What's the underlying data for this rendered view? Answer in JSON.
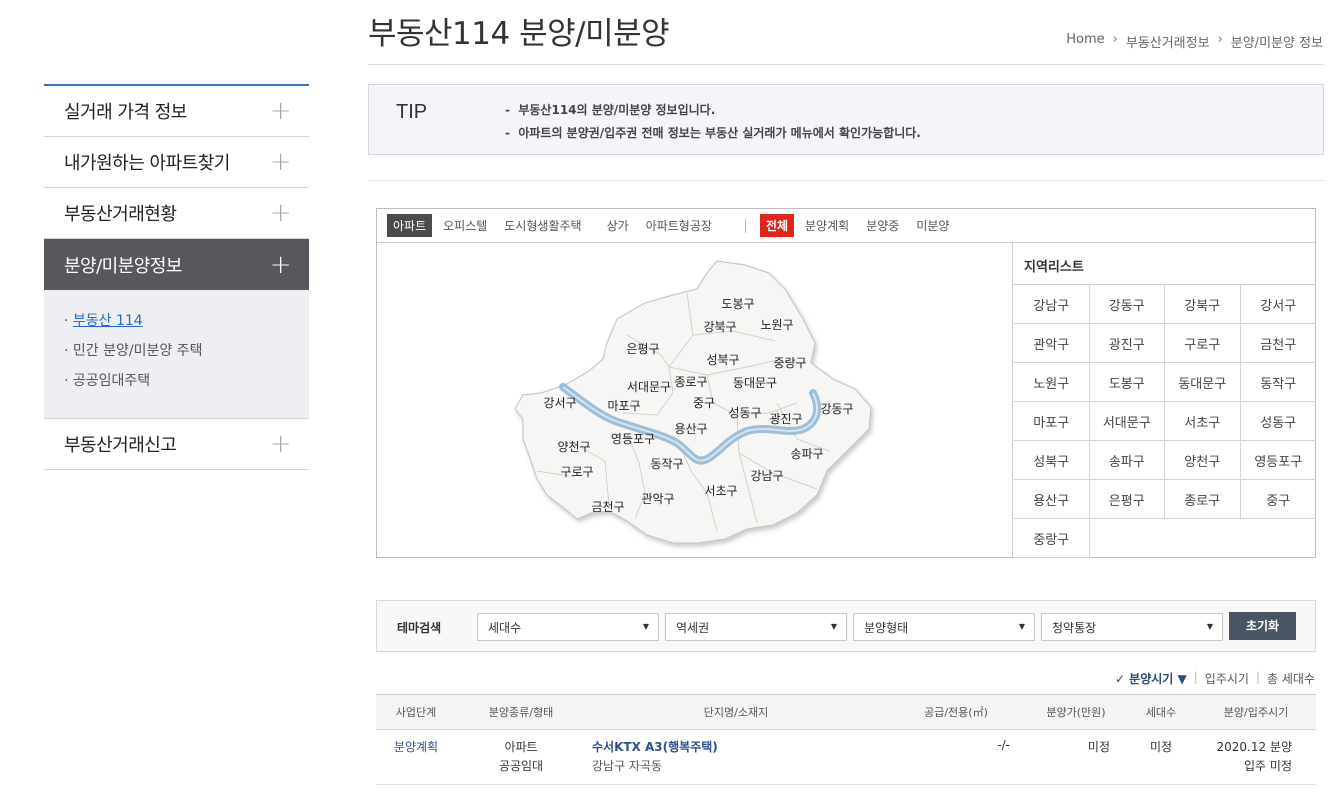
{
  "header": {
    "title": "부동산114 분양/미분양",
    "breadcrumb": [
      "Home",
      "부동산거래정보",
      "분양/미분양 정보"
    ]
  },
  "sidebar": {
    "items": [
      {
        "label": "실거래 가격 정보"
      },
      {
        "label": "내가원하는 아파트찾기"
      },
      {
        "label": "부동산거래현황"
      },
      {
        "label": "분양/미분양정보"
      },
      {
        "label": "부동산거래신고"
      }
    ],
    "sub_items": [
      {
        "label": "부동산 114"
      },
      {
        "label": "민간 분양/미분양 주택"
      },
      {
        "label": "공공임대주택"
      }
    ]
  },
  "tip": {
    "label": "TIP",
    "lines": [
      "부동산114의 분양/미분양 정보입니다.",
      "아파트의 분양권/입주권 전매 정보는 부동산 실거래가 메뉴에서 확인가능합니다."
    ]
  },
  "tabs": {
    "type_tabs": [
      "아파트",
      "오피스텔",
      "도시형생활주택",
      "상가",
      "아파트형공장"
    ],
    "status_tabs": [
      "전체",
      "분양계획",
      "분양중",
      "미분양"
    ]
  },
  "map": {
    "districts": [
      "도봉구",
      "강북구",
      "노원구",
      "은평구",
      "성북구",
      "중랑구",
      "서대문구",
      "종로구",
      "동대문구",
      "강서구",
      "마포구",
      "중구",
      "성동구",
      "광진구",
      "강동구",
      "양천구",
      "영등포구",
      "용산구",
      "송파구",
      "구로구",
      "동작구",
      "강남구",
      "금천구",
      "관악구",
      "서초구"
    ]
  },
  "regions": {
    "title": "지역리스트",
    "list": [
      "강남구",
      "강동구",
      "강북구",
      "강서구",
      "관악구",
      "광진구",
      "구로구",
      "금천구",
      "노원구",
      "도봉구",
      "동대문구",
      "동작구",
      "마포구",
      "서대문구",
      "서초구",
      "성동구",
      "성북구",
      "송파구",
      "양천구",
      "영등포구",
      "용산구",
      "은평구",
      "종로구",
      "중구",
      "중랑구"
    ]
  },
  "theme_search": {
    "label": "테마검색",
    "selects": [
      "세대수",
      "역세권",
      "분양형태",
      "청약통장"
    ],
    "reset_label": "초기화"
  },
  "sort": {
    "options": [
      "분양시기",
      "입주시기",
      "총 세대수"
    ],
    "active": "분양시기"
  },
  "table": {
    "headers": [
      "사업단계",
      "분양종류/형태",
      "단지명/소재지",
      "공급/전용(㎡)",
      "분양가(만원)",
      "세대수",
      "분양/입주시기"
    ],
    "rows": [
      {
        "stage": "분양계획",
        "kind": "아파트",
        "form": "공공임대",
        "name": "수서KTX A3(행복주택)",
        "address": "강남구 자곡동",
        "area": "-/-",
        "price": "미정",
        "units": "미정",
        "sale_date": "2020.12 분양",
        "move_date": "입주 미정"
      }
    ]
  }
}
